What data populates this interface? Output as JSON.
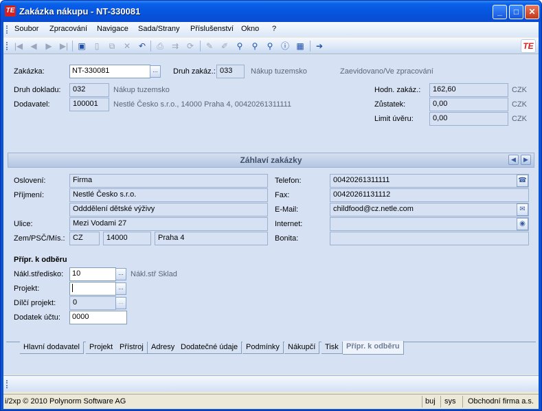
{
  "window": {
    "title": "Zakázka nákupu - NT-330081",
    "app_icon": "app-logo-icon",
    "minimize": "_",
    "maximize": "□",
    "close": "✕"
  },
  "menu": [
    "Soubor",
    "Zpracování",
    "Navigace",
    "Sada/Strany",
    "Příslušenství",
    "Okno",
    "?"
  ],
  "toolbar": {
    "icons": [
      "first-icon",
      "prev-icon",
      "next-icon",
      "last-icon",
      "save-icon",
      "new-icon",
      "copy-icon",
      "delete-icon",
      "undo-icon",
      "print-icon",
      "export-icon",
      "refresh-icon",
      "edit-icon",
      "edit-alt-icon",
      "search-icon",
      "zoom-icon",
      "find-user-icon",
      "info-icon",
      "calculator-icon",
      "exit-icon"
    ],
    "logo": "TE"
  },
  "header": {
    "zakazka_label": "Zakázka:",
    "zakazka_value": "NT-330081",
    "druh_zakaz_label": "Druh zakáz.:",
    "druh_zakaz_value": "033",
    "druh_zakaz_text": "Nákup tuzemsko",
    "status": "Zaevidovano/Ve zpracování",
    "druh_dokladu_label": "Druh dokladu:",
    "druh_dokladu_value": "032",
    "druh_dokladu_text": "Nákup tuzemsko",
    "dodavatel_label": "Dodavatel:",
    "dodavatel_value": "100001",
    "dodavatel_text": "Nestlé Česko s.r.o., 14000 Praha 4, 00420261311111",
    "hodn_label": "Hodn. zakáz.:",
    "hodn_value": "162,60",
    "zustatek_label": "Zůstatek:",
    "zustatek_value": "0,00",
    "limit_label": "Limit úvěru:",
    "limit_value": "0,00",
    "currency": "CZK"
  },
  "section": {
    "title": "Záhlaví zakázky",
    "prev": "◀",
    "next": "▶"
  },
  "address": {
    "osloveni_label": "Oslovení:",
    "osloveni": "Firma",
    "prijmeni_label": "Příjmení:",
    "prijmeni": "Nestlé Česko s.r.o.",
    "prijmeni2": "Odddělení dětské výživy",
    "ulice_label": "Ulice:",
    "ulice": "Mezi Vodami 27",
    "zem_label": "Zem/PSČ/Mís.:",
    "zem": "CZ",
    "psc": "14000",
    "misto": "Praha 4",
    "telefon_label": "Telefon:",
    "telefon": "00420261311111",
    "fax_label": "Fax:",
    "fax": "00420261131112",
    "email_label": "E-Mail:",
    "email": "childfood@cz.netle.com",
    "internet_label": "Internet:",
    "internet": "",
    "bonita_label": "Bonita:",
    "bonita": ""
  },
  "odber": {
    "title": "Přípr. k odběru",
    "nakl_label": "Nákl.středisko:",
    "nakl_value": "10",
    "nakl_text": "Nákl.stř Sklad",
    "projekt_label": "Projekt:",
    "projekt_value": "",
    "dilci_label": "Dílčí projekt:",
    "dilci_value": "0",
    "dodatek_label": "Dodatek účtu:",
    "dodatek_value": "0000"
  },
  "tabs": [
    "Hlavní dodavatel",
    "Projekt",
    "Přístroj",
    "Adresy",
    "Dodatečné údaje",
    "Podmínky",
    "Nákupčí",
    "Tisk",
    "Přípr. k odběru"
  ],
  "statusbar": {
    "copyright": "i/2xp © 2010 Polynorm Software AG",
    "user": "buj",
    "system": "sys",
    "company": "Obchodní firma a.s."
  }
}
